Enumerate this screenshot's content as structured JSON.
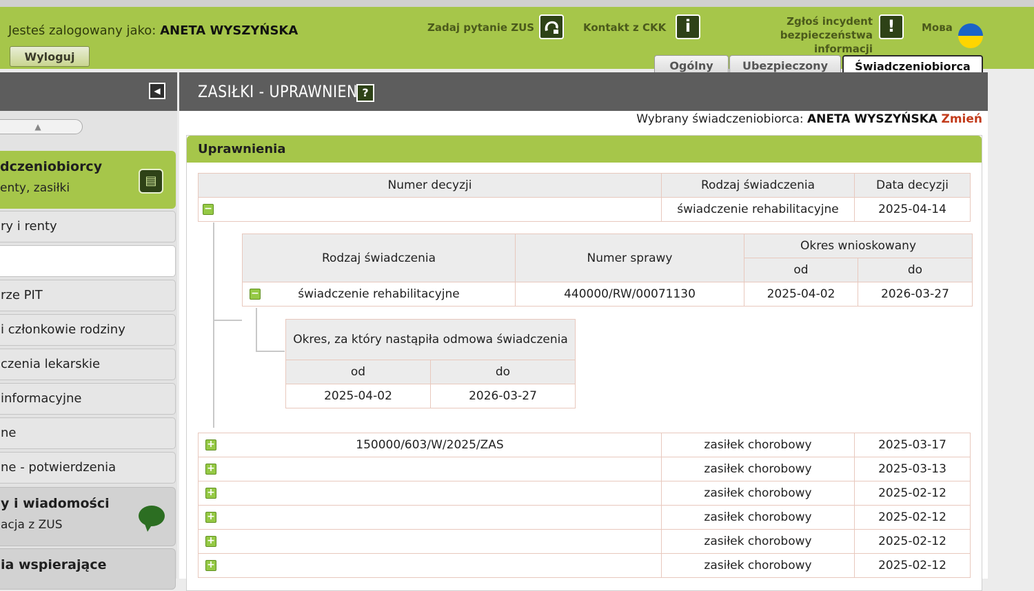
{
  "header": {
    "login_prefix": "Jesteś zalogowany jako:",
    "user_name": "ANETA WYSZYŃSKA",
    "logout_label": "Wyloguj",
    "ask_zus_label": "Zadaj pytanie ZUS",
    "contact_ckk_label": "Kontakt z CKK",
    "incident_line1": "Zgłoś incydent",
    "incident_line2": "bezpieczeństwa informacji",
    "language_label": "Мова",
    "tabs": [
      {
        "label": "Ogólny"
      },
      {
        "label": "Ubezpieczony"
      },
      {
        "label": "Świadczeniobiorca"
      }
    ]
  },
  "sidebar": {
    "group_benefits": {
      "title": "dczeniobiorcy",
      "subtitle": "enty, zasiłki"
    },
    "items": [
      {
        "label": "ry i renty"
      },
      {
        "label": ""
      },
      {
        "label": "rze PIT"
      },
      {
        "label": "i członkowie rodziny"
      },
      {
        "label": "czenia lekarskie"
      },
      {
        "label": "informacyjne"
      },
      {
        "label": "ne"
      },
      {
        "label": "ne - potwierdzenia"
      }
    ],
    "group_messages": {
      "title": "y i wiadomości",
      "subtitle": "acja z ZUS"
    },
    "group_support": {
      "title": "ia wspierające"
    }
  },
  "main": {
    "page_title": "ZASIŁKI - UPRAWNIENIA",
    "help_label": "?",
    "selected_prefix": "Wybrany świadczeniobiorca:",
    "selected_name": "ANETA WYSZYŃSKA",
    "change_label": "Zmień",
    "panel_title": "Uprawnienia"
  },
  "decisions_table": {
    "headers": {
      "decision_number": "Numer decyzji",
      "benefit_type": "Rodzaj świadczenia",
      "decision_date": "Data decyzji"
    },
    "expanded_row": {
      "expander": "−",
      "number": "",
      "type": "świadczenie rehabilitacyjne",
      "date": "2025-04-14"
    },
    "rows": [
      {
        "expander": "+",
        "number": "150000/603/W/2025/ZAS",
        "type": "zasiłek chorobowy",
        "date": "2025-03-17"
      },
      {
        "expander": "+",
        "number": "",
        "type": "zasiłek chorobowy",
        "date": "2025-03-13"
      },
      {
        "expander": "+",
        "number": "",
        "type": "zasiłek chorobowy",
        "date": "2025-02-12"
      },
      {
        "expander": "+",
        "number": "",
        "type": "zasiłek chorobowy",
        "date": "2025-02-12"
      },
      {
        "expander": "+",
        "number": "",
        "type": "zasiłek chorobowy",
        "date": "2025-02-12"
      },
      {
        "expander": "+",
        "number": "",
        "type": "zasiłek chorobowy",
        "date": "2025-02-12"
      }
    ]
  },
  "case_table": {
    "headers": {
      "benefit_type": "Rodzaj świadczenia",
      "case_number": "Numer sprawy",
      "requested_period": "Okres wnioskowany",
      "from": "od",
      "to": "do"
    },
    "row": {
      "expander": "−",
      "type": "świadczenie rehabilitacyjne",
      "case_number": "440000/RW/00071130",
      "from": "2025-04-02",
      "to": "2026-03-27"
    }
  },
  "refusal_table": {
    "headers": {
      "period": "Okres, za który nastąpiła odmowa świadczenia",
      "from": "od",
      "to": "do"
    },
    "row": {
      "from": "2025-04-02",
      "to": "2026-03-27"
    }
  },
  "colors": {
    "header_green": "#a6c64a",
    "dark_gray": "#5d5d5d",
    "icon_dark_green": "#2e4217",
    "change_link": "#c23b1b"
  }
}
